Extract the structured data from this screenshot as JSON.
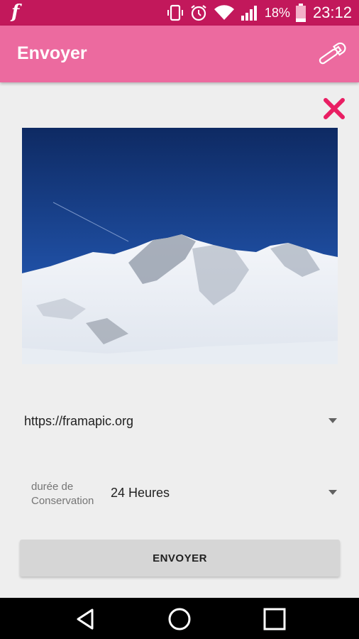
{
  "status_bar": {
    "battery_percent": "18%",
    "time": "23:12",
    "icons": [
      "framapic-app-icon",
      "vibrate-icon",
      "alarm-icon",
      "wifi-icon",
      "signal-icon",
      "battery-icon"
    ]
  },
  "app_bar": {
    "title": "Envoyer",
    "settings_icon": "wrench-icon"
  },
  "main": {
    "close_icon": "close-icon",
    "image_subject": "snowy mountain under blue sky",
    "server": {
      "value": "https://framapic.org"
    },
    "duration": {
      "label": "durée de Conservation",
      "value": "24 Heures"
    },
    "send_button_label": "ENVOYER"
  },
  "nav_bar": {
    "icons": [
      "back-icon",
      "home-icon",
      "recents-icon"
    ]
  },
  "colors": {
    "status_bar": "#c2185b",
    "app_bar": "#ec6a9f",
    "close": "#e91e63",
    "background": "#eeeeee"
  }
}
